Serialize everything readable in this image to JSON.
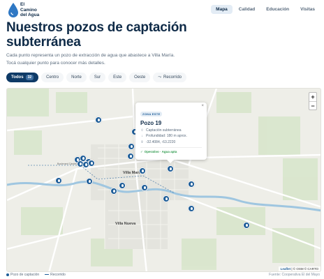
{
  "brand": {
    "line1": "El",
    "line2": "Camino",
    "line3": "del Agua"
  },
  "nav": {
    "items": [
      "Mapa",
      "Calidad",
      "Educación",
      "Visitas"
    ],
    "active": "Mapa"
  },
  "header": {
    "title": "Nuestros pozos de captación subterránea",
    "description": "Cada punto representa un pozo de extracción de agua que abastece a Villa María. Tocá cualquier punto para conocer más detalles."
  },
  "filters": {
    "todos": "Todos",
    "todos_count": "32",
    "items": [
      "Centro",
      "Norte",
      "Sur",
      "Este",
      "Oeste"
    ],
    "route": "Recorrido"
  },
  "map": {
    "places": {
      "villa_maria": "Villa María",
      "villa_nueva": "Villa Nueva",
      "boulevard": "Boulevard Cárdenas"
    },
    "zoom_in": "+",
    "zoom_out": "−",
    "popup": {
      "zone": "ZONA ESTE",
      "title": "Pozo 19",
      "type": "Captación subterránea",
      "depth": "Profundidad: 180 m aprox.",
      "coords": "-32.4084, -63.2220",
      "status": "Operativo · Agua apta",
      "close": "×"
    },
    "attribution": {
      "leaflet": "Leaflet",
      "rest": "| © OSM © CARTO"
    }
  },
  "legend": {
    "well": "Pozo de captación",
    "route": "Recorrido"
  },
  "source": "Fuente: Cooperativa El del Mayo",
  "colors": {
    "primary": "#0e3a66",
    "pin": "#1e5d98",
    "ok": "#2e9a4d"
  }
}
